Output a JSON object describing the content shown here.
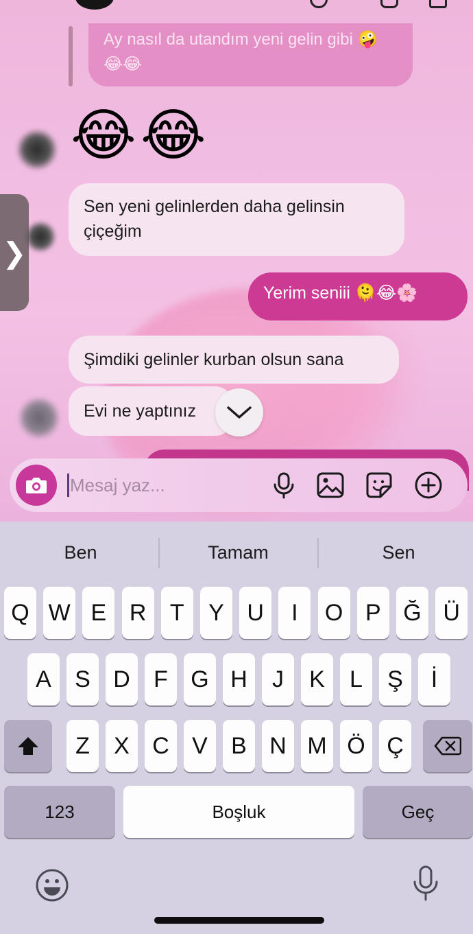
{
  "chat": {
    "reply_preview": {
      "line1": "Ay nasıl da utandım yeni gelin gibi 🤪",
      "line2": "😂😂"
    },
    "big_emoji": "😂😂",
    "messages": [
      {
        "text_line1": "Sen yeni gelinlerden daha gelinsin",
        "text_line2": "çiçeğim"
      },
      {
        "text": "Yerim seniii 🫠😂🌸"
      },
      {
        "text": "Şimdiki gelinler kurban olsun sana"
      },
      {
        "text": "Evi ne yaptınız"
      }
    ],
    "side_tab_glyph": "❯"
  },
  "composer": {
    "placeholder": "Mesaj yaz...",
    "value": ""
  },
  "keyboard": {
    "suggestions": [
      "Ben",
      "Tamam",
      "Sen"
    ],
    "row1": [
      "Q",
      "W",
      "E",
      "R",
      "T",
      "Y",
      "U",
      "I",
      "O",
      "P",
      "Ğ",
      "Ü"
    ],
    "row2": [
      "A",
      "S",
      "D",
      "F",
      "G",
      "H",
      "J",
      "K",
      "L",
      "Ş",
      "İ"
    ],
    "row3": [
      "Z",
      "X",
      "C",
      "V",
      "B",
      "N",
      "M",
      "Ö",
      "Ç"
    ],
    "numbers_key": "123",
    "space_key": "Boşluk",
    "return_key": "Geç",
    "shift_icon": "shift-icon",
    "backspace_icon": "backspace-icon",
    "emoji_icon": "emoji-icon",
    "dictation_icon": "microphone-icon"
  },
  "colors": {
    "outgoing_bubble": "#cc3a93",
    "incoming_bubble": "#f7e4f1",
    "camera_button": "#c8379a"
  }
}
